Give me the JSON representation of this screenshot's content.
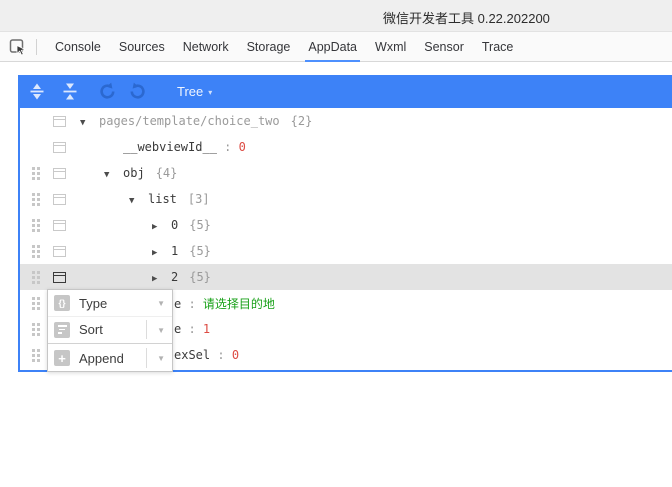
{
  "window": {
    "title": "微信开发者工具 0.22.202200"
  },
  "tabbar": {
    "tabs": [
      "Console",
      "Sources",
      "Network",
      "Storage",
      "AppData",
      "Wxml",
      "Sensor",
      "Trace"
    ],
    "active_tab": "AppData"
  },
  "toolbar": {
    "buttons": [
      {
        "name": "expand-all-button",
        "icon": "expand-all-icon"
      },
      {
        "name": "collapse-all-button",
        "icon": "collapse-all-icon"
      },
      {
        "name": "undo-button",
        "icon": "undo-icon",
        "disabled": true
      },
      {
        "name": "redo-button",
        "icon": "redo-icon",
        "disabled": true
      }
    ],
    "view_select": {
      "label": "Tree",
      "caret": "▾"
    }
  },
  "tree": {
    "colon": " : ",
    "icons": {
      "expanded": "▼",
      "collapsed": "▶"
    },
    "rows": [
      {
        "level": 0,
        "expander": "expanded",
        "key": "pages/template/choice_two",
        "key_style": "muted",
        "count": "{2}",
        "handle": false,
        "selected": false
      },
      {
        "level": 1,
        "expander": "none",
        "key": "__webviewId__",
        "key_style": "normal",
        "value": "0",
        "value_style": "number",
        "handle": false,
        "selected": false
      },
      {
        "level": 1,
        "expander": "expanded",
        "key": "obj",
        "key_style": "normal",
        "count": "{4}",
        "handle": true,
        "selected": false
      },
      {
        "level": 2,
        "expander": "expanded",
        "key": "list",
        "key_style": "normal",
        "count": "[3]",
        "handle": true,
        "selected": false
      },
      {
        "level": 3,
        "expander": "collapsed",
        "key": "0",
        "key_style": "normal",
        "count": "{5}",
        "handle": true,
        "selected": false
      },
      {
        "level": 3,
        "expander": "collapsed",
        "key": "1",
        "key_style": "normal",
        "count": "{5}",
        "handle": true,
        "selected": false
      },
      {
        "level": 3,
        "expander": "collapsed",
        "key": "2",
        "key_style": "normal",
        "count": "{5}",
        "handle": true,
        "selected": true
      },
      {
        "fragment": true,
        "key": "e",
        "key_style": "normal",
        "value": "请选择目的地",
        "value_style": "string",
        "handle": true,
        "selected": false
      },
      {
        "fragment": true,
        "key": "e",
        "key_style": "normal",
        "value": "1",
        "value_style": "number",
        "handle": true,
        "selected": false
      },
      {
        "fragment": true,
        "key": "exSel",
        "key_style": "normal",
        "value": "0",
        "value_style": "number",
        "handle": true,
        "selected": false
      }
    ]
  },
  "context_menu": {
    "items": [
      {
        "label": "Type",
        "icon": "braces-icon",
        "caret": "▼",
        "vsep": false,
        "divider_above": false
      },
      {
        "label": "Sort",
        "icon": "sort-lines-icon",
        "caret": "▼",
        "vsep": true,
        "divider_above": false
      },
      {
        "label": "Append",
        "icon": "plus-icon",
        "caret": "▼",
        "vsep": true,
        "divider_above": true
      }
    ]
  },
  "colors": {
    "toolbar_blue": "#3d82f7",
    "tab_underline": "#4d90fe",
    "selected_row_bg": "#e3e3e3",
    "number_value": "#dd4b43",
    "string_value": "#19a119",
    "muted_text": "#9a9a9a",
    "key_text": "#3a3a3a"
  }
}
